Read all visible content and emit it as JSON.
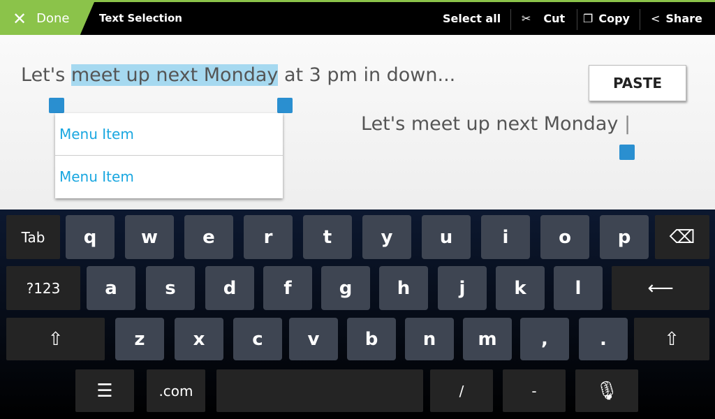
{
  "actionbar": {
    "done": "Done",
    "title": "Text Selection",
    "select_all": "Select all",
    "cut": "Cut",
    "copy": "Copy",
    "share": "Share",
    "accent": "#8bc34a"
  },
  "content": {
    "text_before": "Let's ",
    "text_selected": "meet up next Monday",
    "text_after": " at 3 pm in down...",
    "menu_items": [
      "Menu Item",
      "Menu Item"
    ],
    "paste": "PASTE",
    "field_text": "Let's meet up next Monday",
    "selection_color": "#a6d9f0",
    "handle_color": "#2a8fd0"
  },
  "keyboard": {
    "rows": [
      [
        "Tab",
        "q",
        "w",
        "e",
        "r",
        "t",
        "y",
        "u",
        "i",
        "o",
        "p",
        "backspace-icon"
      ],
      [
        "?123",
        "a",
        "s",
        "d",
        "f",
        "g",
        "h",
        "j",
        "k",
        "l",
        "enter-icon"
      ],
      [
        "shift-icon",
        "z",
        "x",
        "c",
        "v",
        "b",
        "n",
        "m",
        ",",
        ".",
        "shift-icon"
      ],
      [
        "settings-icon",
        ".com",
        "",
        "/",
        "-",
        "mic-icon"
      ]
    ]
  }
}
